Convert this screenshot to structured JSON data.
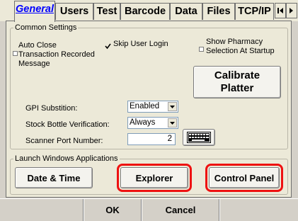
{
  "tabs": [
    {
      "label": "General",
      "active": true
    },
    {
      "label": "Users",
      "active": false
    },
    {
      "label": "Test",
      "active": false
    },
    {
      "label": "Barcode",
      "active": false
    },
    {
      "label": "Data",
      "active": false
    },
    {
      "label": "Files",
      "active": false
    },
    {
      "label": "TCP/IP",
      "active": false
    }
  ],
  "common_settings": {
    "group_label": "Common Settings",
    "auto_close_label": "Auto Close\nTransaction Recorded\nMessage",
    "auto_close_checked": false,
    "skip_login_label": "Skip User Login",
    "skip_login_checked": true,
    "show_pharmacy_label": "Show Pharmacy\nSelection At Startup",
    "show_pharmacy_checked": false,
    "calibrate_label": "Calibrate\nPlatter",
    "gpi_label": "GPI Substition:",
    "gpi_value": "Enabled",
    "stock_label": "Stock Bottle Verification:",
    "stock_value": "Always",
    "scanner_label": "Scanner Port Number:",
    "scanner_value": "2"
  },
  "launch": {
    "group_label": "Launch Windows Applications",
    "date_time_label": "Date & Time",
    "explorer_label": "Explorer",
    "control_panel_label": "Control Panel",
    "highlight_color": "#ee1111"
  },
  "footer": {
    "ok_label": "OK",
    "cancel_label": "Cancel"
  }
}
